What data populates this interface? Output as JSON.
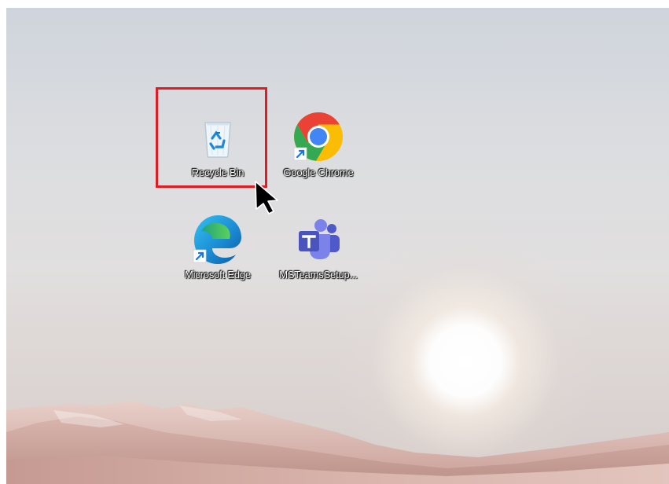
{
  "desktop": {
    "icons": [
      {
        "id": "recycle-bin",
        "label": "Recycle Bin",
        "icon": "recycle-bin-icon"
      },
      {
        "id": "google-chrome",
        "label": "Google Chrome",
        "icon": "chrome-icon"
      },
      {
        "id": "microsoft-edge",
        "label": "Microsoft Edge",
        "icon": "edge-icon"
      },
      {
        "id": "msteams-setup",
        "label": "MSTeamsSetup...",
        "icon": "teams-icon"
      }
    ]
  },
  "annotation": {
    "highlight_color": "#e11b22",
    "highlighted_item": "Recycle Bin"
  }
}
